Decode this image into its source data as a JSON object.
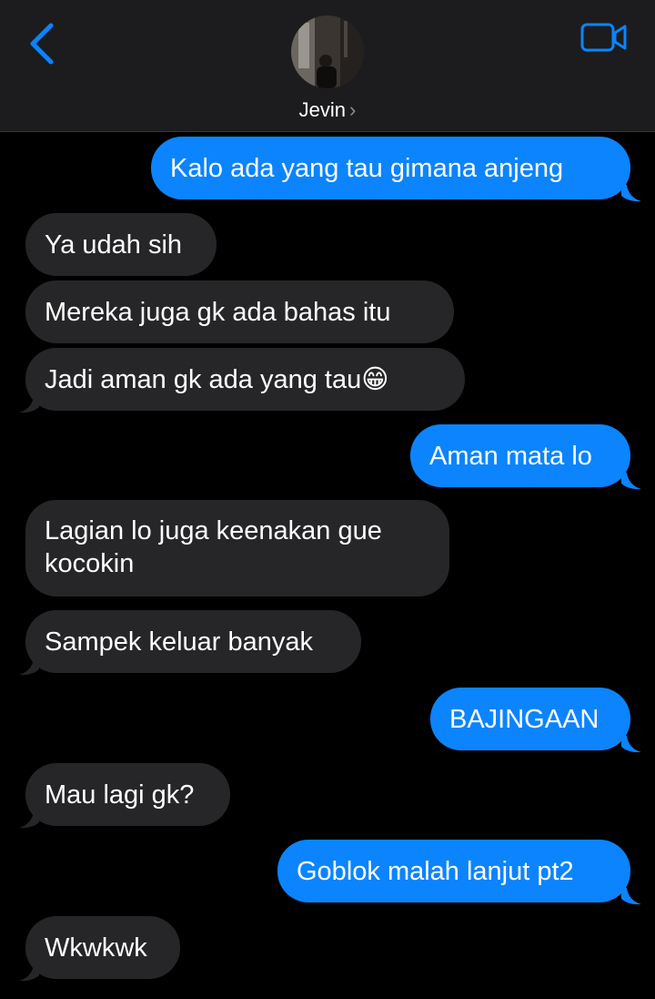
{
  "header": {
    "contact_name": "Jevin",
    "chevron": "›",
    "icons": {
      "back": "chevron-left-icon",
      "video": "video-camera-icon"
    },
    "accent_color": "#0a84ff"
  },
  "colors": {
    "outgoing_bubble": "#0b84fe",
    "incoming_bubble": "#262628",
    "background": "#000000",
    "header_background": "#1c1c1e"
  },
  "messages": [
    {
      "direction": "out",
      "text": "Kalo ada yang tau gimana anjeng"
    },
    {
      "direction": "in",
      "text": "Ya udah sih"
    },
    {
      "direction": "in",
      "text": "Mereka juga gk ada bahas itu"
    },
    {
      "direction": "in",
      "text": "Jadi aman gk ada yang tau😁"
    },
    {
      "direction": "out",
      "text": "Aman mata lo"
    },
    {
      "direction": "in",
      "text": "Lagian lo juga keenakan gue kocokin"
    },
    {
      "direction": "in",
      "text": "Sampek keluar banyak"
    },
    {
      "direction": "out",
      "text": "BAJINGAAN"
    },
    {
      "direction": "in",
      "text": "Mau lagi gk?"
    },
    {
      "direction": "out",
      "text": "Goblok malah lanjut pt2"
    },
    {
      "direction": "in",
      "text": "Wkwkwk"
    }
  ]
}
